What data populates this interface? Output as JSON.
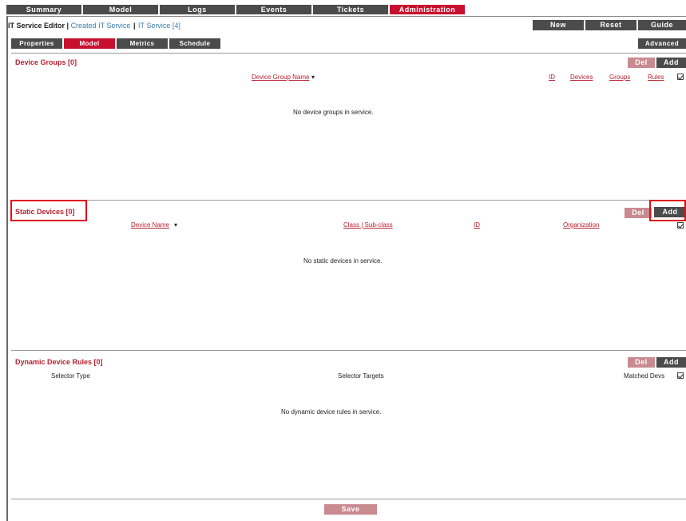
{
  "topnav": {
    "tabs": [
      "Summary",
      "Model",
      "Logs",
      "Events",
      "Tickets",
      "Administration"
    ]
  },
  "header": {
    "title_prefix": "IT Service Editor |",
    "crumb1": "Created IT Service",
    "sep": "|",
    "crumb2": "IT Service [4]",
    "new_label": "New",
    "reset_label": "Reset",
    "guide_label": "Guide"
  },
  "subtabs": [
    "Properties",
    "Model",
    "Metrics",
    "Schedule"
  ],
  "advanced_label": "Advanced",
  "device_groups": {
    "title": "Device Groups [0]",
    "del_label": "Del",
    "add_label": "Add",
    "columns": [
      "Device Group Name",
      "ID",
      "Devices",
      "Groups",
      "Rules"
    ],
    "sort_marker": "▾",
    "empty": "No device groups in service."
  },
  "static_devices": {
    "title": "Static Devices [0]",
    "del_label": "Del",
    "add_label": "Add",
    "columns": [
      "Device Name",
      "Class | Sub-class",
      "ID",
      "Organization"
    ],
    "sort_marker": "▾",
    "empty": "No static devices in service."
  },
  "dynamic_rules": {
    "title": "Dynamic Device Rules [0]",
    "del_label": "Del",
    "add_label": "Add",
    "columns": [
      "Selector Type",
      "Selector Targets",
      "Matched Devs"
    ],
    "empty": "No dynamic device rules in service."
  },
  "footer": {
    "save_label": "Save"
  },
  "colors": {
    "accent": "#c8102e",
    "dark_button": "#4b4b4b",
    "disabled_button": "#c98a90",
    "link": "#3a7fb0",
    "highlight": "#e0101a"
  }
}
